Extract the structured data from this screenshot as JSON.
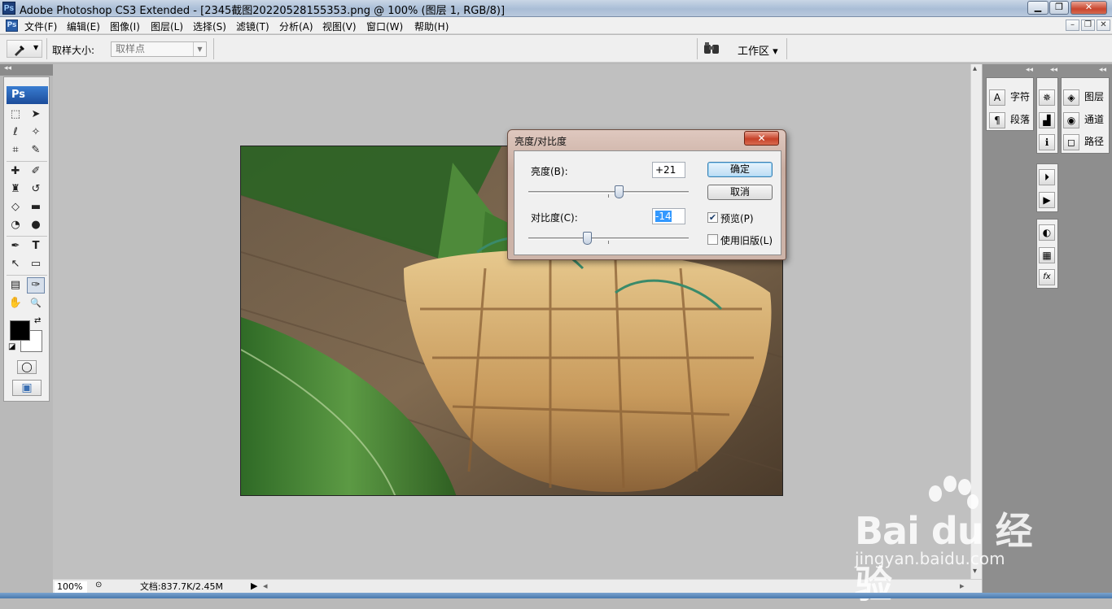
{
  "window": {
    "app_icon": "Ps",
    "title": "Adobe Photoshop CS3 Extended - [2345截图20220528155353.png @ 100% (图层 1, RGB/8)]",
    "controls": {
      "minimize": "▁",
      "restore": "❐",
      "close": "✕"
    }
  },
  "menu": {
    "doc_icon": "Ps",
    "items": [
      "文件(F)",
      "编辑(E)",
      "图像(I)",
      "图层(L)",
      "选择(S)",
      "滤镜(T)",
      "分析(A)",
      "视图(V)",
      "窗口(W)",
      "帮助(H)"
    ],
    "mdi_controls": {
      "minimize": "–",
      "restore": "❐",
      "close": "✕"
    }
  },
  "options_bar": {
    "tool_icon": "eyedropper-icon",
    "sample_size_label": "取样大小:",
    "sample_size_value": "取样点",
    "workspace_label": "工作区 ▾",
    "workspace_icon": "binoculars-icon"
  },
  "toolbox": {
    "logo": "Ps",
    "tools": [
      {
        "name": "marquee",
        "glyph": "⬚"
      },
      {
        "name": "move",
        "glyph": "➤"
      },
      {
        "name": "lasso",
        "glyph": "ℓ"
      },
      {
        "name": "magic-wand",
        "glyph": "✧"
      },
      {
        "name": "crop",
        "glyph": "⌗"
      },
      {
        "name": "slice",
        "glyph": "✎"
      },
      {
        "name": "healing",
        "glyph": "✚"
      },
      {
        "name": "brush",
        "glyph": "✐"
      },
      {
        "name": "stamp",
        "glyph": "♜"
      },
      {
        "name": "history-brush",
        "glyph": "↺"
      },
      {
        "name": "eraser",
        "glyph": "◇"
      },
      {
        "name": "gradient",
        "glyph": "▬"
      },
      {
        "name": "blur",
        "glyph": "◔"
      },
      {
        "name": "dodge",
        "glyph": "●"
      },
      {
        "name": "pen",
        "glyph": "✒"
      },
      {
        "name": "type",
        "glyph": "T"
      },
      {
        "name": "path-selection",
        "glyph": "↖"
      },
      {
        "name": "shape",
        "glyph": "▭"
      },
      {
        "name": "notes",
        "glyph": "▤"
      },
      {
        "name": "eyedropper",
        "glyph": "✑"
      },
      {
        "name": "hand",
        "glyph": "✋"
      },
      {
        "name": "zoom",
        "glyph": "🔍"
      }
    ],
    "swap_icon": "⇄",
    "default_icon": "◪",
    "quick_mask_icon": "◯",
    "screen_mode_icon": "▣"
  },
  "status_bar": {
    "zoom": "100%",
    "doc_size": "文档:837.7K/2.45M",
    "arrow": "▶",
    "scroll_left": "◂",
    "scroll_right": "▸"
  },
  "vscroll": {
    "up": "▴",
    "down": "▾"
  },
  "panels": {
    "collapse": "◂◂",
    "group1": [
      {
        "label": "字符",
        "icon_name": "character-icon",
        "glyph": "A"
      },
      {
        "label": "段落",
        "icon_name": "paragraph-icon",
        "glyph": "¶"
      }
    ],
    "group2": [
      {
        "icon_name": "navigator-icon",
        "glyph": "✵"
      },
      {
        "icon_name": "histogram-icon",
        "glyph": "▟"
      },
      {
        "icon_name": "info-icon",
        "glyph": "ℹ"
      }
    ],
    "group3": [
      {
        "label": "图层",
        "icon_name": "layers-icon",
        "glyph": "◈"
      },
      {
        "label": "通道",
        "icon_name": "channels-icon",
        "glyph": "◉"
      },
      {
        "label": "路径",
        "icon_name": "paths-icon",
        "glyph": "◻"
      }
    ],
    "group4": [
      {
        "icon_name": "history-icon",
        "glyph": "⏵"
      },
      {
        "icon_name": "actions-icon",
        "glyph": "▶"
      }
    ],
    "group5": [
      {
        "icon_name": "color-icon",
        "glyph": "◐"
      },
      {
        "icon_name": "swatches-icon",
        "glyph": "▦"
      },
      {
        "icon_name": "styles-icon",
        "glyph": "fx"
      }
    ]
  },
  "dialog": {
    "title": "亮度/对比度",
    "close_label": "✕",
    "brightness_label": "亮度(B):",
    "brightness_value": "+21",
    "brightness_fraction": 0.57,
    "contrast_label": "对比度(C):",
    "contrast_value": "-14",
    "contrast_fraction": 0.37,
    "ok_label": "确定",
    "cancel_label": "取消",
    "preview_label": "预览(P)",
    "preview_checked": true,
    "legacy_label": "使用旧版(L)",
    "legacy_checked": false
  },
  "watermark": {
    "brand": "Bai du 经验",
    "url": "jingyan.baidu.com"
  }
}
